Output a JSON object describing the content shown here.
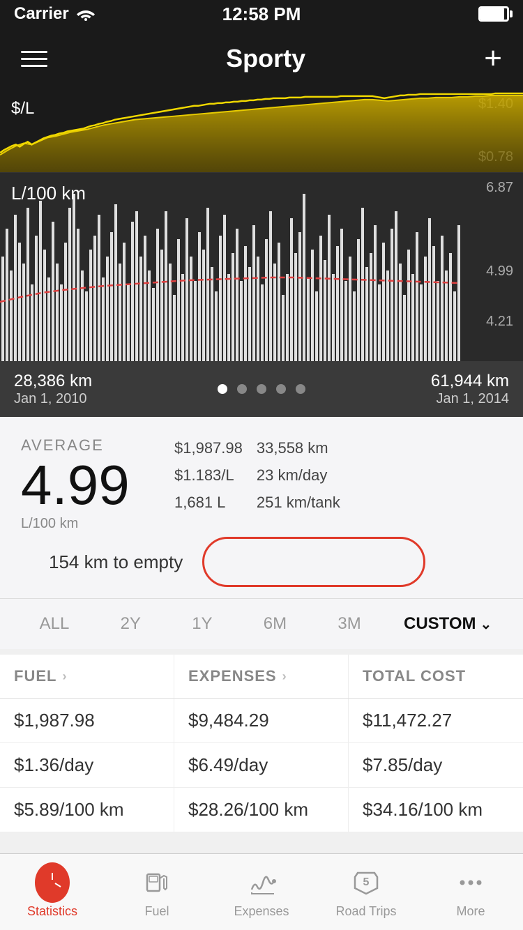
{
  "statusBar": {
    "carrier": "Carrier",
    "time": "12:58 PM"
  },
  "navBar": {
    "title": "Sporty",
    "plusLabel": "+"
  },
  "fuelChart": {
    "label": "$/L",
    "high": "$1.40",
    "low": "$0.78"
  },
  "consumptionChart": {
    "label": "L/100 km",
    "high": "6.87",
    "mid": "4.99",
    "low": "4.21"
  },
  "chartFooter": {
    "leftKm": "28,386 km",
    "leftDate": "Jan 1, 2010",
    "rightKm": "61,944 km",
    "rightDate": "Jan 1, 2014"
  },
  "stats": {
    "avgLabel": "AVERAGE",
    "avgValue": "4.99",
    "avgUnit": "L/100 km",
    "col1": [
      "$1,987.98",
      "$1.183/L",
      "1,681 L"
    ],
    "col2": [
      "33,558 km",
      "23 km/day",
      "251 km/tank"
    ],
    "kteText": "154 km to empty"
  },
  "timeFilter": {
    "buttons": [
      "ALL",
      "2Y",
      "1Y",
      "6M",
      "3M"
    ],
    "active": "CUSTOM",
    "customLabel": "CUSTOM"
  },
  "table": {
    "headers": [
      "FUEL",
      "EXPENSES",
      "TOTAL COST"
    ],
    "rows": [
      [
        "$1,987.98",
        "$9,484.29",
        "$11,472.27"
      ],
      [
        "$1.36/day",
        "$6.49/day",
        "$7.85/day"
      ],
      [
        "$5.89/100 km",
        "$28.26/100 km",
        "$34.16/100 km"
      ]
    ]
  },
  "bottomNav": {
    "items": [
      "Statistics",
      "Fuel",
      "Expenses",
      "Road Trips",
      "More"
    ]
  }
}
